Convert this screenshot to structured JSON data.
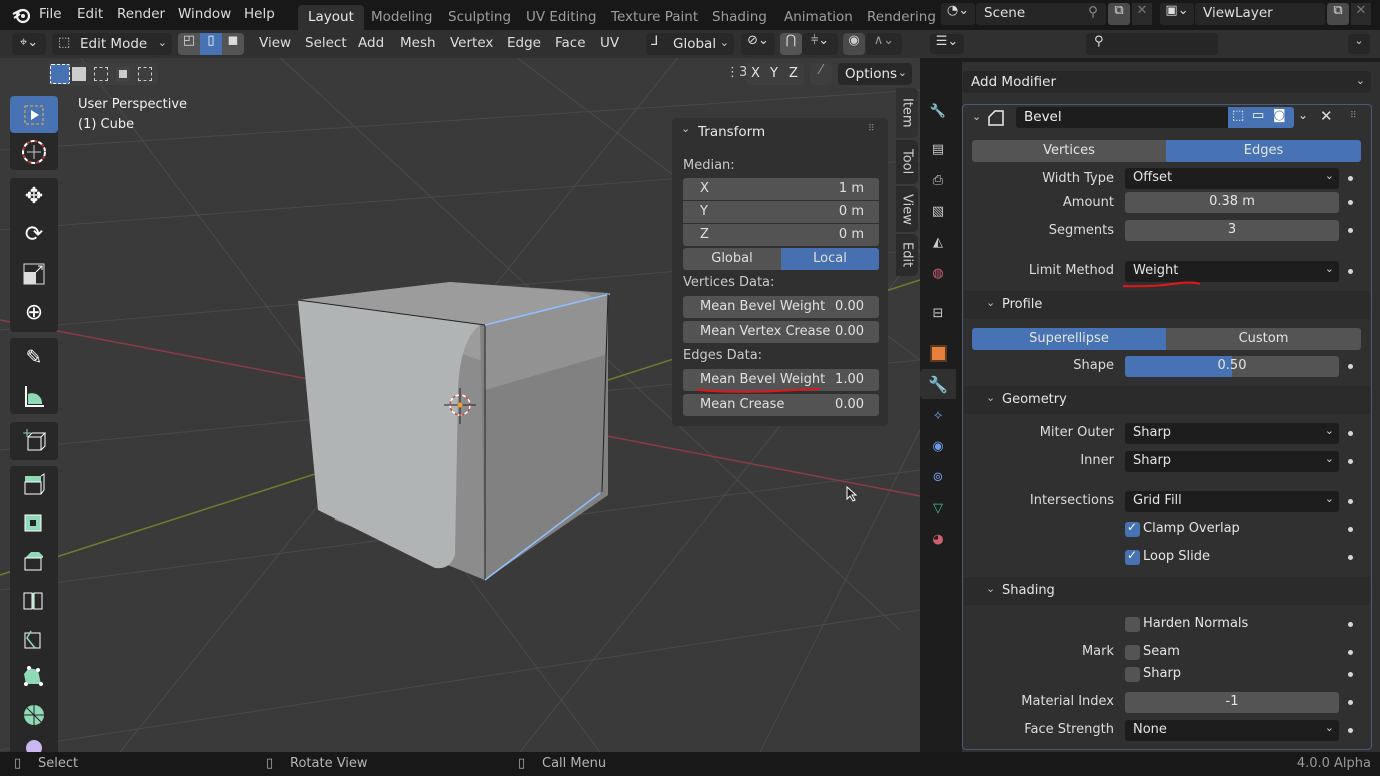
{
  "topbar": {
    "menus": [
      "File",
      "Edit",
      "Render",
      "Window",
      "Help"
    ],
    "workspaces": [
      "Layout",
      "Modeling",
      "Sculpting",
      "UV Editing",
      "Texture Paint",
      "Shading",
      "Animation",
      "Rendering"
    ],
    "active_workspace": "Layout",
    "scene": "Scene",
    "view_layer": "ViewLayer"
  },
  "viewport_header": {
    "mode": "Edit Mode",
    "menus": [
      "View",
      "Select",
      "Add",
      "Mesh",
      "Vertex",
      "Edge",
      "Face",
      "UV"
    ],
    "orientation": "Global",
    "axes": [
      "X",
      "Y",
      "Z"
    ],
    "options_label": "Options",
    "select_mode_active": "edge"
  },
  "viewport": {
    "perspective_label": "User Perspective",
    "object_label": "(1) Cube"
  },
  "npanel": {
    "section_title": "Transform",
    "median_label": "Median:",
    "median": [
      {
        "axis": "X",
        "value": "1 m"
      },
      {
        "axis": "Y",
        "value": "0 m"
      },
      {
        "axis": "Z",
        "value": "0 m"
      }
    ],
    "space_options": [
      "Global",
      "Local"
    ],
    "space_active": "Local",
    "vertices_label": "Vertices Data:",
    "vertices": [
      {
        "label": "Mean Bevel Weight",
        "value": "0.00"
      },
      {
        "label": "Mean Vertex Crease",
        "value": "0.00"
      }
    ],
    "edges_label": "Edges Data:",
    "edges": [
      {
        "label": "Mean Bevel Weight",
        "value": "1.00"
      },
      {
        "label": "Mean Crease",
        "value": "0.00"
      }
    ],
    "side_tabs": [
      "Item",
      "Tool",
      "View",
      "Edit"
    ],
    "side_tab_active": "Item"
  },
  "properties": {
    "add_modifier_label": "Add Modifier",
    "modifier_name": "Bevel",
    "affect_options": [
      "Vertices",
      "Edges"
    ],
    "affect_active": "Edges",
    "width_type_label": "Width Type",
    "width_type": "Offset",
    "amount_label": "Amount",
    "amount": "0.38 m",
    "segments_label": "Segments",
    "segments": "3",
    "limit_method_label": "Limit Method",
    "limit_method": "Weight",
    "profile_title": "Profile",
    "profile_options": [
      "Superellipse",
      "Custom"
    ],
    "profile_active": "Superellipse",
    "shape_label": "Shape",
    "shape": "0.50",
    "shape_fraction": 0.5,
    "geometry_title": "Geometry",
    "miter_outer_label": "Miter Outer",
    "miter_outer": "Sharp",
    "inner_label": "Inner",
    "inner": "Sharp",
    "intersections_label": "Intersections",
    "intersections": "Grid Fill",
    "clamp_overlap_label": "Clamp Overlap",
    "clamp_overlap": true,
    "loop_slide_label": "Loop Slide",
    "loop_slide": true,
    "shading_title": "Shading",
    "harden_normals_label": "Harden Normals",
    "harden_normals": false,
    "mark_label": "Mark",
    "seam_label": "Seam",
    "seam": false,
    "sharp_label": "Sharp",
    "sharp": false,
    "material_index_label": "Material Index",
    "material_index": "-1",
    "face_strength_label": "Face Strength",
    "face_strength": "None"
  },
  "statusbar": {
    "left": "Select",
    "middle": "Rotate View",
    "right": "Call Menu",
    "version": "4.0.0 Alpha"
  },
  "colors": {
    "accent": "#4772b3",
    "annotation_red": "#e8141c",
    "selected_edge": "#7fb4ff"
  }
}
